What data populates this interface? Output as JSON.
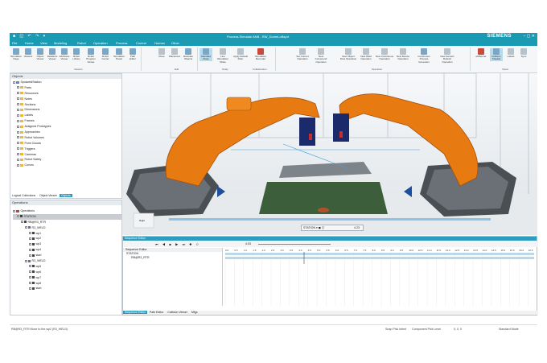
{
  "titlebar": {
    "title": "Process Simulate ANB - RW_DomeLoBsprt",
    "brand": "SIEMENS",
    "quick_access": "■ ◱ ↶ ↷ ▾"
  },
  "menu": [
    "File",
    "Home",
    "View",
    "Modeling",
    "Robot",
    "Operation",
    "Process",
    "Control",
    "Human",
    "Other"
  ],
  "ribbon": {
    "buttons": [
      "Simulation Page",
      "Viewers",
      "Object Viewer",
      "Relations Viewer",
      "Attributes Viewer",
      "Robot Library",
      "Robot Program Viewer",
      "Robot Center",
      "Simulation Panel",
      "Path Editor",
      "Move",
      "Placement",
      "Relocate Objects",
      "Standard Mode",
      "Line Simulation Mode",
      "Apply Default Filter",
      "Simulation Recorder",
      "Set Current Operation",
      "New Compound Operation",
      "New Object Flow Operation",
      "New Weld Operation",
      "New Continuous Operation",
      "New Device Operation",
      "Continuous Process Generator",
      "New Generic Robotic Operation",
      "eMServer",
      "Collision Shaded",
      "Labels",
      "Sync"
    ],
    "groups": [
      "Viewers",
      "Edit",
      "Study",
      "Collaboration",
      "Operation",
      "Views"
    ]
  },
  "objects_panel": {
    "title": "Objects",
    "items": [
      "SpotweldStation",
      "Parts",
      "Resources",
      "Notes",
      "Sections",
      "Dimensions",
      "Labels",
      "Frames",
      "Assigned Prototypes",
      "Approaches",
      "Robot Volumes",
      "Point Clouds",
      "Triggers",
      "Cameras",
      "Robot Safety",
      "Curves"
    ],
    "tabs": [
      "Logical Collections",
      "Object Viewer",
      "Objects"
    ]
  },
  "operations_panel": {
    "title": "Operations",
    "items": [
      "Operations",
      "STATION",
      "RB@R3_RTR",
      "R3_WELD",
      "wp1",
      "wp2",
      "wp3",
      "wp4",
      "start",
      "R3_WELD",
      "wp5",
      "wp6",
      "wp7",
      "wp8",
      "start"
    ]
  },
  "viewport": {
    "view_label": "Right",
    "bottom_bar": "STATION ▾ ◼ ◫",
    "bottom_val": "4.23"
  },
  "sequence_editor": {
    "title": "Sequence Editor",
    "column": "Sequence Editor",
    "rows": [
      "STATION",
      "RB@R3_RTR"
    ],
    "ticks": [
      "0.0",
      "0.5",
      "1.0",
      "1.5",
      "2.0",
      "2.5",
      "3.0",
      "3.5",
      "4.0",
      "4.5",
      "5.0",
      "5.5",
      "6.0",
      "6.5",
      "7.0",
      "7.5",
      "8.0",
      "8.5",
      "9.0",
      "9.5",
      "10.0",
      "10.5",
      "11.0",
      "11.5",
      "12.0",
      "12.5",
      "13.0",
      "13.5",
      "14.0",
      "14.5",
      "15.0",
      "15.5",
      "16.0",
      "16.5"
    ],
    "time_readout": "4.03",
    "tabs": [
      "Sequence Editor",
      "Path Editor",
      "Collision Viewer",
      "Mfgs"
    ]
  },
  "status": {
    "left": "RB@R3_RTR Move to the wp2 (R3_WELD)",
    "snap": "Snap Pick Intent",
    "pick": "Component Pick Level",
    "coords": "0, 0, 0",
    "mode": "Standard Mode"
  },
  "colors": {
    "accent": "#1b9bb3",
    "robot": "#e87a12",
    "floor": "#3a5a3a"
  }
}
